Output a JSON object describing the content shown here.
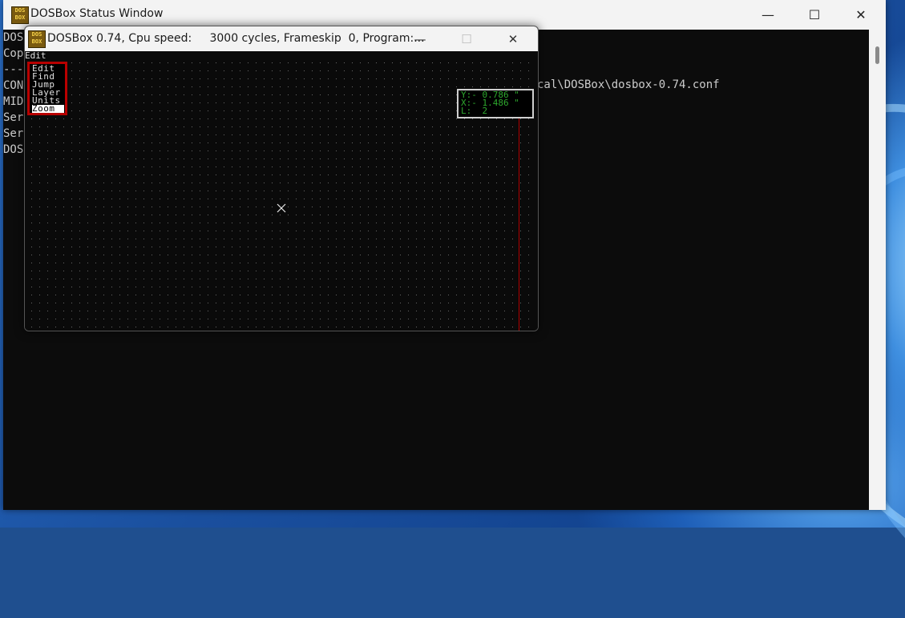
{
  "status_window": {
    "title": "DOSBox Status Window",
    "icon_text": "DOS BOX",
    "minimize": "—",
    "maximize": "☐",
    "close": "✕",
    "console_lines": [
      "DOS",
      "Cop",
      "---",
      "",
      "CON",
      "MID",
      "Ser",
      "Ser",
      "DOS"
    ],
    "config_path": "cal\\DOSBox\\dosbox-0.74.conf"
  },
  "dosbox_window": {
    "title": "DOSBox 0.74, Cpu speed:     3000 cycles, Frameskip  0, Program:...",
    "icon_text": "DOS BOX",
    "minimize": "—",
    "maximize": "☐",
    "close": "✕",
    "menu_title": "Edit",
    "menu_items": [
      "Edit",
      "Find",
      "Jump",
      "Layer",
      "Units",
      "Zoom"
    ],
    "selected_item": "Zoom",
    "coords": {
      "y": "Y:- 0.786 \"",
      "x": "X:- 1.486 \"",
      "l": "L:  2"
    }
  },
  "colors": {
    "menu_border": "#b80000",
    "coord_text": "#2ea82e",
    "console_bg": "#0c0c0c"
  }
}
